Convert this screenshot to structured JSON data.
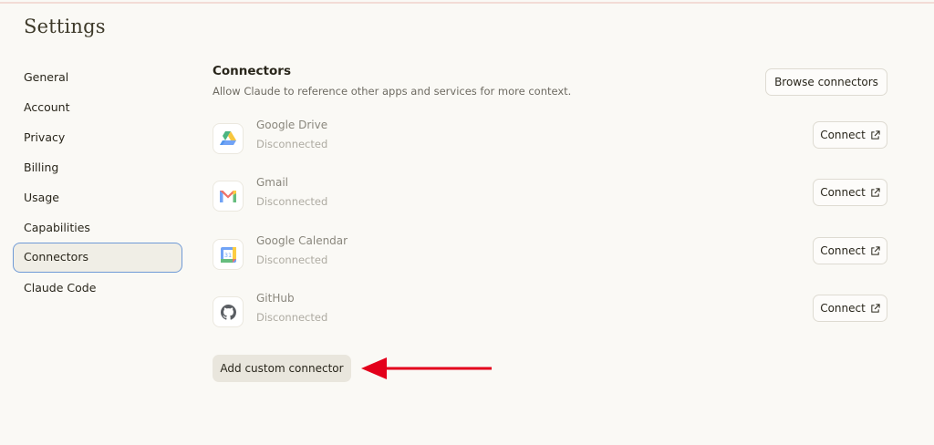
{
  "header": {
    "title": "Settings"
  },
  "sidebar": {
    "items": [
      {
        "label": "General"
      },
      {
        "label": "Account"
      },
      {
        "label": "Privacy"
      },
      {
        "label": "Billing"
      },
      {
        "label": "Usage"
      },
      {
        "label": "Capabilities"
      },
      {
        "label": "Connectors",
        "active": true
      },
      {
        "label": "Claude Code"
      }
    ]
  },
  "connectors": {
    "title": "Connectors",
    "description": "Allow Claude to reference other apps and services for more context.",
    "browse_label": "Browse connectors",
    "items": [
      {
        "name": "Google Drive",
        "status": "Disconnected",
        "button": "Connect",
        "icon": "google-drive-icon"
      },
      {
        "name": "Gmail",
        "status": "Disconnected",
        "button": "Connect",
        "icon": "gmail-icon"
      },
      {
        "name": "Google Calendar",
        "status": "Disconnected",
        "button": "Connect",
        "icon": "google-calendar-icon"
      },
      {
        "name": "GitHub",
        "status": "Disconnected",
        "button": "Connect",
        "icon": "github-icon"
      }
    ],
    "add_custom_label": "Add custom connector"
  },
  "calendar_icon_day": "31",
  "colors": {
    "accent_outline": "#6f9ad6",
    "annotation_arrow": "#e3001b",
    "background": "#faf9f5"
  }
}
